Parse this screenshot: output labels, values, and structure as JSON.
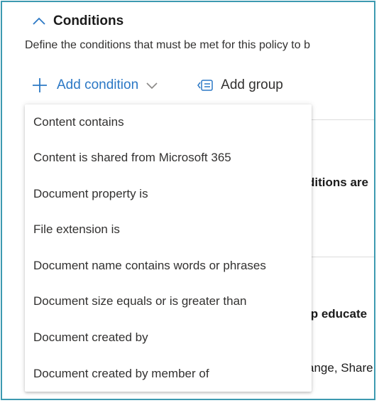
{
  "section": {
    "title": "Conditions",
    "description": "Define the conditions that must be met for this policy to b"
  },
  "toolbar": {
    "add_condition_label": "Add condition",
    "add_group_label": "Add group"
  },
  "background": {
    "text_1": "ditions are",
    "text_2": "lp educate",
    "text_3": "ange, Share"
  },
  "dropdown": {
    "items": [
      "Content contains",
      "Content is shared from Microsoft 365",
      "Document property is",
      "File extension is",
      "Document name contains words or phrases",
      "Document size equals or is greater than",
      "Document created by",
      "Document created by member of"
    ]
  },
  "colors": {
    "accent": "#2b78c5",
    "frame_border": "#3d9ab0",
    "text": "#323130"
  },
  "icons": {
    "collapse": "chevron-up-icon",
    "add": "plus-icon",
    "expand": "chevron-down-icon",
    "group": "add-group-icon"
  }
}
